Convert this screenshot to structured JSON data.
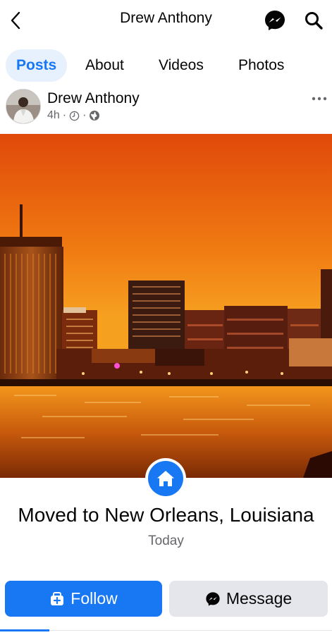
{
  "header": {
    "title": "Drew Anthony",
    "back_icon": "chevron-left-icon",
    "messenger_icon": "messenger-icon",
    "search_icon": "search-icon"
  },
  "tabs": [
    {
      "label": "Posts",
      "active": true
    },
    {
      "label": "About",
      "active": false
    },
    {
      "label": "Videos",
      "active": false
    },
    {
      "label": "Photos",
      "active": false
    }
  ],
  "post": {
    "author": "Drew Anthony",
    "time": "4h",
    "sep": "·"
  },
  "life_event": {
    "title": "Moved to New Orleans, Louisiana",
    "date": "Today"
  },
  "actions": {
    "follow_label": "Follow",
    "message_label": "Message"
  },
  "colors": {
    "accent": "#1877f2",
    "secondary_bg": "#e4e6eb",
    "muted_text": "#65676b"
  }
}
